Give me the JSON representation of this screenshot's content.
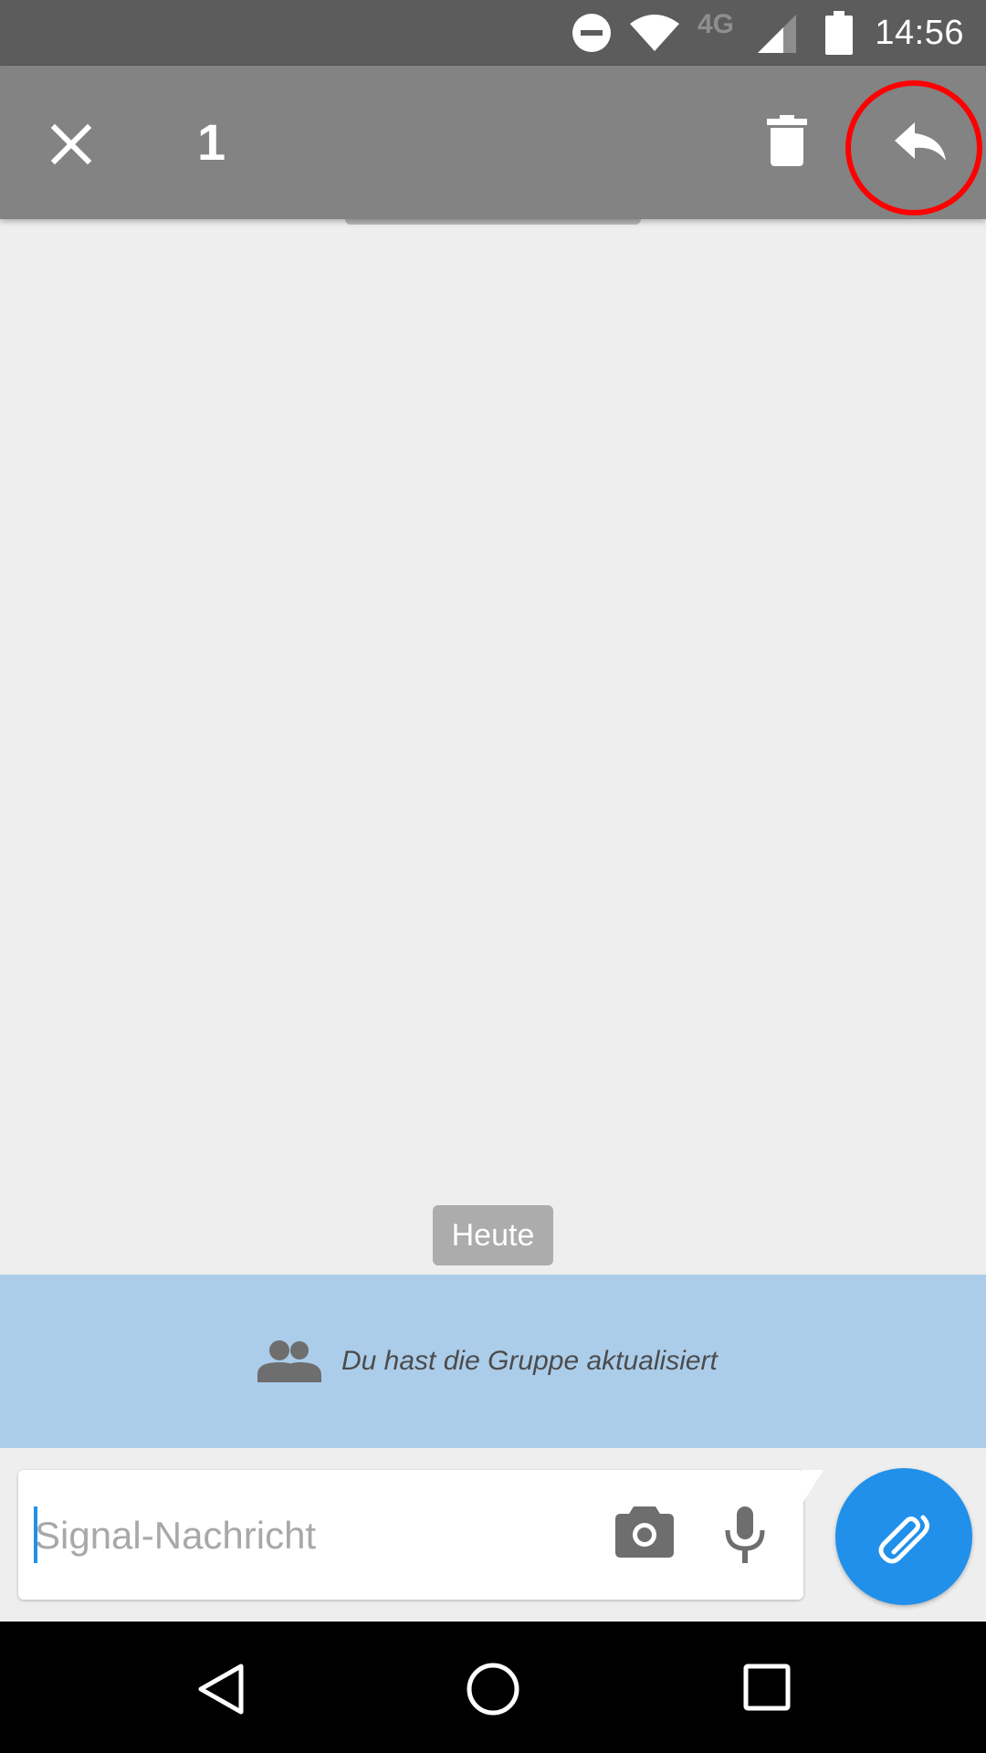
{
  "status_bar": {
    "time": "14:56",
    "network_label": "4G",
    "icons": [
      "do-not-disturb-icon",
      "wifi-icon",
      "cell-signal-icon",
      "battery-icon"
    ]
  },
  "selection_toolbar": {
    "selected_count": "1",
    "icons": [
      "close-icon",
      "delete-icon",
      "reply-icon"
    ]
  },
  "conversation": {
    "date_divider": "Heute",
    "group_update": {
      "icon": "group-icon",
      "text": "Du hast die Gruppe aktualisiert"
    }
  },
  "composer": {
    "placeholder": "Signal-Nachricht",
    "value": "",
    "icons": [
      "camera-icon",
      "microphone-icon",
      "attach-icon"
    ]
  },
  "navigation_bar": {
    "icons": [
      "back-icon",
      "home-icon",
      "recents-icon"
    ]
  },
  "colors": {
    "status_bar": "#5c5c5c",
    "toolbar": "#838383",
    "background": "#eeeeee",
    "group_banner": "#abcdea",
    "accent": "#2090ea",
    "highlight": "#ff0000"
  }
}
